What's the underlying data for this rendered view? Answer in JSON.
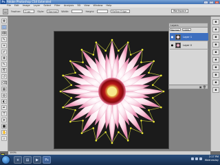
{
  "window": {
    "title": "Adobe Photoshop CS4 Extended",
    "logo": "Ps"
  },
  "menu": [
    "File",
    "Edit",
    "Image",
    "Layer",
    "Select",
    "Filter",
    "Analysis",
    "3D",
    "View",
    "Window",
    "Help"
  ],
  "options": {
    "feather_label": "Feather:",
    "feather_value": "0 px",
    "style_label": "Style:",
    "style_value": "Normal",
    "width_label": "Width:",
    "height_label": "Height:",
    "refine_edge": "Refine Edge...",
    "workspace": "Workspace"
  },
  "tools": [
    "move-tool",
    "marquee-tool",
    "lasso-tool",
    "quick-select-tool",
    "crop-tool",
    "eyedropper-tool",
    "healing-tool",
    "brush-tool",
    "clone-tool",
    "history-brush-tool",
    "eraser-tool",
    "gradient-tool",
    "blur-tool",
    "dodge-tool",
    "pen-tool",
    "type-tool",
    "path-select-tool",
    "shape-tool",
    "hand-tool",
    "zoom-tool"
  ],
  "colors": {
    "foreground": "#f5ed2a",
    "background": "#ffffff",
    "accent": "#3e6fbf",
    "anchor_points": "#f2ee35"
  },
  "layers_panel": {
    "tab": "Layers",
    "blend_mode": "Normal",
    "opacity": "100%",
    "layers": [
      {
        "name": "Layer 1",
        "selected": true
      },
      {
        "name": "Layer 0",
        "selected": false
      }
    ]
  },
  "status": {
    "zoom": "100%"
  },
  "taskbar": {
    "time": "2:17 PM",
    "day": "Wednesday"
  }
}
